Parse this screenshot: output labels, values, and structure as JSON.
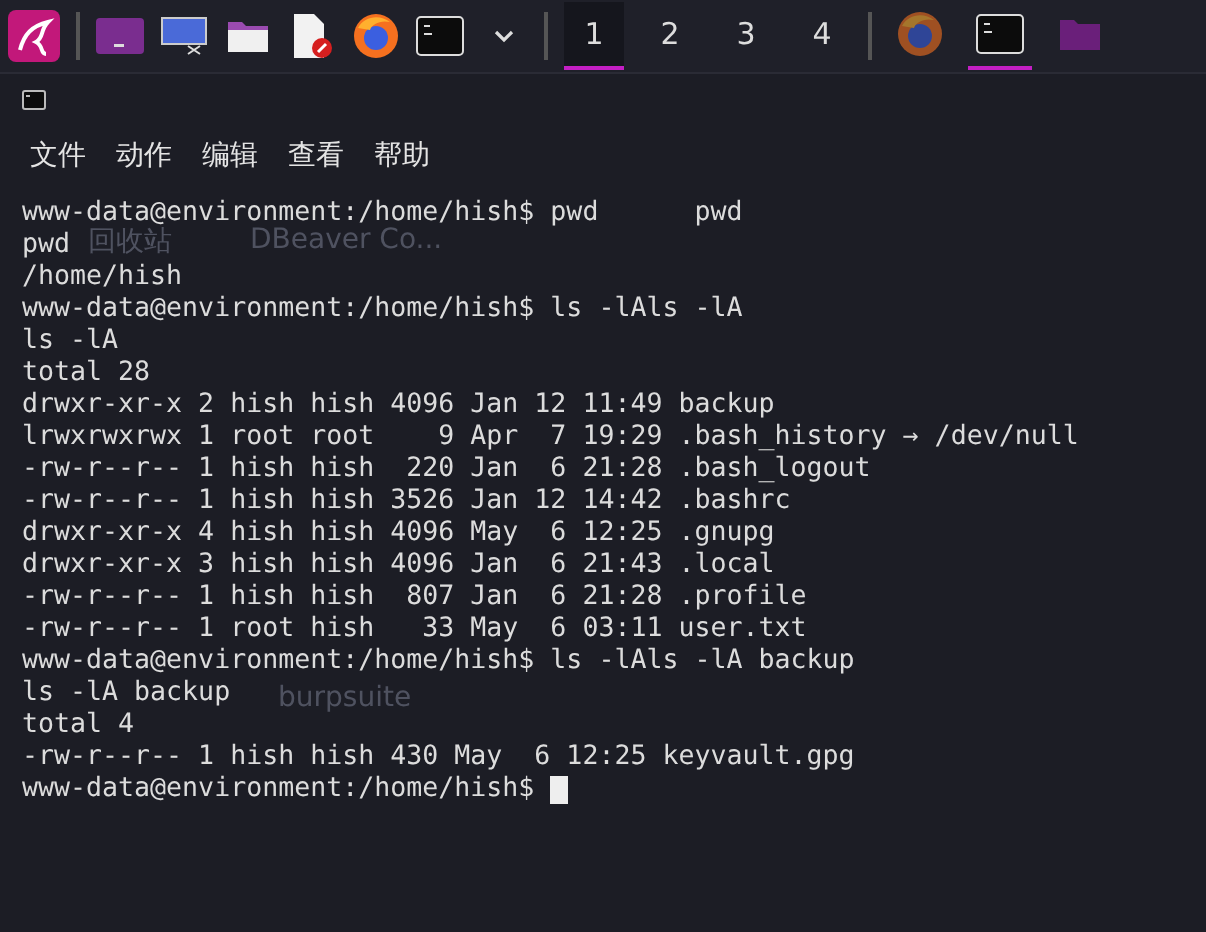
{
  "taskbar": {
    "launchers": [
      {
        "kind": "menu"
      },
      {
        "kind": "purple-terminal"
      },
      {
        "kind": "screen"
      },
      {
        "kind": "folder"
      },
      {
        "kind": "editor"
      },
      {
        "kind": "browser"
      },
      {
        "kind": "terminal"
      },
      {
        "kind": "caret"
      }
    ],
    "pager": [
      {
        "label": "1",
        "selected": true
      },
      {
        "label": "2",
        "selected": false
      },
      {
        "label": "3",
        "selected": false
      },
      {
        "label": "4",
        "selected": false
      }
    ],
    "tasks": [
      {
        "kind": "browser",
        "selected": false
      },
      {
        "kind": "terminal",
        "selected": true
      },
      {
        "kind": "folder",
        "selected": false
      }
    ]
  },
  "desktop_labels": [
    "回收站",
    "DBeaver Co...",
    "burpsuite"
  ],
  "menu": [
    "文件",
    "动作",
    "编辑",
    "查看",
    "帮助"
  ],
  "terminal": {
    "lines": [
      "www-data@environment:/home/hish$ pwd      pwd",
      "pwd",
      "/home/hish",
      "www-data@environment:/home/hish$ ls -lAls -lA",
      "ls -lA",
      "total 28",
      "drwxr-xr-x 2 hish hish 4096 Jan 12 11:49 backup",
      "lrwxrwxrwx 1 root root    9 Apr  7 19:29 .bash_history → /dev/null",
      "-rw-r--r-- 1 hish hish  220 Jan  6 21:28 .bash_logout",
      "-rw-r--r-- 1 hish hish 3526 Jan 12 14:42 .bashrc",
      "drwxr-xr-x 4 hish hish 4096 May  6 12:25 .gnupg",
      "drwxr-xr-x 3 hish hish 4096 Jan  6 21:43 .local",
      "-rw-r--r-- 1 hish hish  807 Jan  6 21:28 .profile",
      "-rw-r--r-- 1 root hish   33 May  6 03:11 user.txt",
      "www-data@environment:/home/hish$ ls -lAls -lA backup",
      "ls -lA backup",
      "total 4",
      "-rw-r--r-- 1 hish hish 430 May  6 12:25 keyvault.gpg",
      "www-data@environment:/home/hish$ "
    ]
  }
}
